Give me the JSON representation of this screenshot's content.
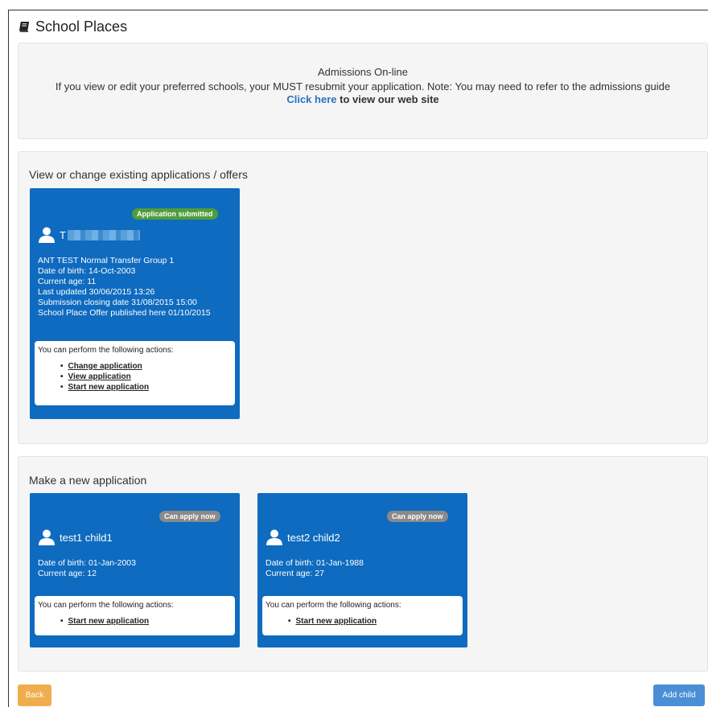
{
  "page": {
    "title": "School Places"
  },
  "admissions": {
    "title": "Admissions On-line",
    "notice": "If you view or edit your preferred schools, your MUST resubmit your application. Note: You may need to refer to the admissions guide",
    "click_here": "Click here",
    "click_here_suffix": " to view our web site"
  },
  "existing": {
    "heading": "View or change existing applications / offers",
    "card": {
      "badge": "Application submitted",
      "name_initial": "T",
      "details": [
        "ANT TEST Normal Transfer Group 1",
        "Date of birth: 14-Oct-2003",
        "Current age: 11",
        "Last updated 30/06/2015 13:26",
        "Submission closing date 31/08/2015 15:00",
        "School Place Offer published here 01/10/2015"
      ],
      "actions_header": "You can perform the following actions:",
      "actions": [
        "Change application",
        "View application",
        "Start new application"
      ]
    }
  },
  "new_application": {
    "heading": "Make a new application",
    "cards": [
      {
        "badge": "Can apply now",
        "name": "test1 child1",
        "details": [
          "Date of birth: 01-Jan-2003",
          "Current age: 12"
        ],
        "actions_header": "You can perform the following actions:",
        "actions": [
          "Start new application"
        ]
      },
      {
        "badge": "Can apply now",
        "name": "test2 child2",
        "details": [
          "Date of birth: 01-Jan-1988",
          "Current age: 27"
        ],
        "actions_header": "You can perform the following actions:",
        "actions": [
          "Start new application"
        ]
      }
    ]
  },
  "buttons": {
    "back": "Back",
    "add_child": "Add child"
  },
  "colors": {
    "card_blue": "#0e6bbf",
    "submitted_green": "#4f9d3a",
    "can_apply_grey": "#8a8a8a",
    "back_orange": "#f0ad4e",
    "add_blue": "#4a8fd6"
  },
  "icons": {
    "title": "book-icon",
    "child": "person-icon"
  }
}
